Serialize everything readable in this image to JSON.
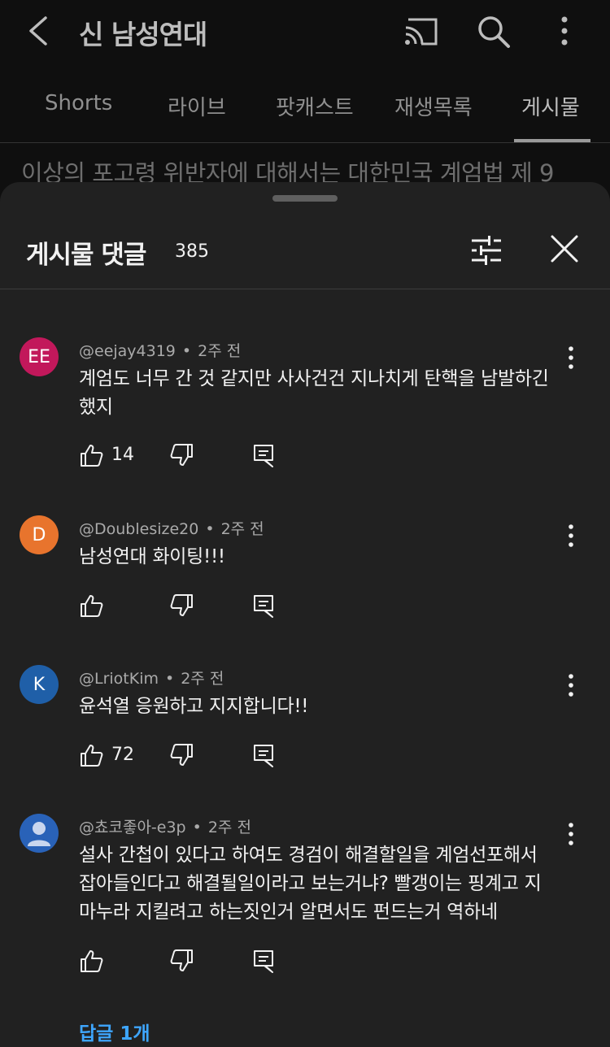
{
  "channel": {
    "title": "신 남성연대"
  },
  "tabs": [
    {
      "label": "Shorts"
    },
    {
      "label": "라이브"
    },
    {
      "label": "팟캐스트"
    },
    {
      "label": "재생목록"
    },
    {
      "label": "게시물"
    }
  ],
  "peek_text": "이상의 포고령 위반자에 대해서는 대한민국 계엄법 제 9",
  "sheet": {
    "title": "게시물 댓글",
    "count": "385"
  },
  "comments": [
    {
      "avatar_text": "EE",
      "avatar_color": "#c2185b",
      "author": "@eejay4319",
      "time": "2주 전",
      "text": "계엄도 너무 간 것 같지만 사사건건 지나치게 탄핵을 남발하긴 했지",
      "likes": "14"
    },
    {
      "avatar_text": "D",
      "avatar_color": "#e8742d",
      "author": "@Doublesize20",
      "time": "2주 전",
      "text": "남성연대  화이팅!!!",
      "likes": ""
    },
    {
      "avatar_text": "K",
      "avatar_color": "#1f5fa8",
      "author": "@LriotKim",
      "time": "2주 전",
      "text": "윤석열 응원하고 지지합니다!!",
      "likes": "72"
    },
    {
      "avatar_text": "",
      "avatar_color": "#2962b8",
      "author": "@쵸코좋아-e3p",
      "time": "2주 전",
      "text": "설사 간첩이 있다고 하여도 경검이 해결할일을 계엄선포해서 잡아들인다고 해결될일이라고 보는거냐?  빨갱이는 핑계고 지 마누라 지킬려고 하는짓인거 알면서도 펀드는거 역하네",
      "likes": ""
    }
  ],
  "replies_link": "답글 1개",
  "colors": {
    "accent": "#3ea6ff",
    "sheet_bg": "#212121",
    "page_bg": "#0f0f0f"
  }
}
